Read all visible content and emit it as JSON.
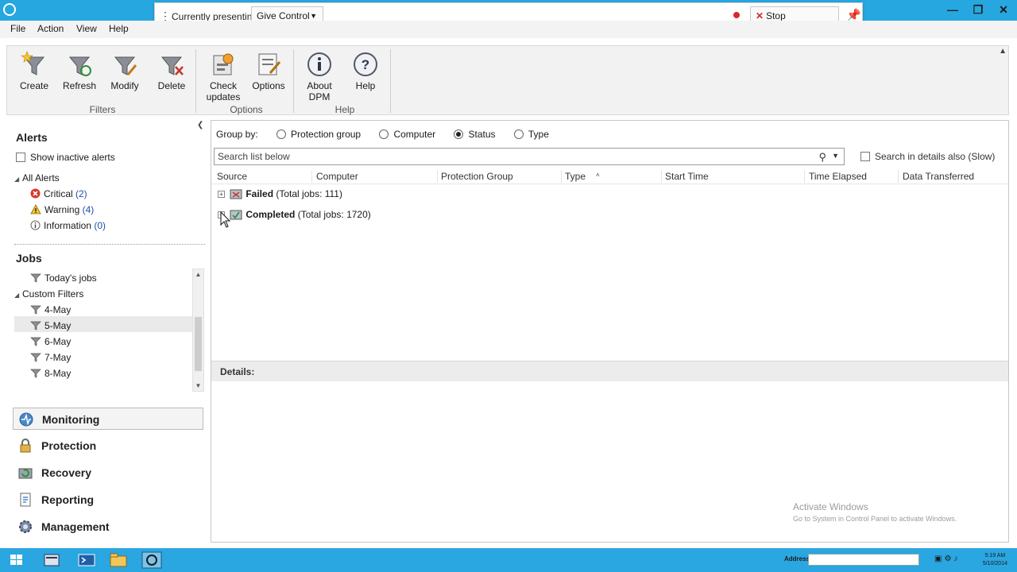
{
  "presenting": {
    "label": "Currently presenting",
    "give_control": "Give Control",
    "stop": "Stop Presenting"
  },
  "menu": [
    "File",
    "Action",
    "View",
    "Help"
  ],
  "ribbon": {
    "buttons": [
      {
        "label": "Create",
        "icon": "funnel-star-icon"
      },
      {
        "label": "Refresh",
        "icon": "funnel-refresh-icon"
      },
      {
        "label": "Modify",
        "icon": "funnel-edit-icon"
      },
      {
        "label": "Delete",
        "icon": "funnel-delete-icon"
      },
      {
        "label": "Check updates",
        "icon": "check-updates-icon"
      },
      {
        "label": "Options",
        "icon": "options-icon"
      },
      {
        "label": "About DPM",
        "icon": "info-icon"
      },
      {
        "label": "Help",
        "icon": "help-icon"
      }
    ],
    "groups": [
      "Filters",
      "Options",
      "Help"
    ]
  },
  "left": {
    "alerts_title": "Alerts",
    "show_inactive": "Show inactive alerts",
    "all_alerts": "All Alerts",
    "critical": {
      "label": "Critical",
      "count": "(2)"
    },
    "warning": {
      "label": "Warning",
      "count": "(4)"
    },
    "information": {
      "label": "Information",
      "count": "(0)"
    },
    "jobs_title": "Jobs",
    "todays_jobs": "Today's jobs",
    "custom_filters": "Custom Filters",
    "filters": [
      "4-May",
      "5-May",
      "6-May",
      "7-May",
      "8-May"
    ],
    "selected_filter": "5-May"
  },
  "nav": [
    {
      "label": "Monitoring",
      "icon": "monitoring-icon"
    },
    {
      "label": "Protection",
      "icon": "protection-icon"
    },
    {
      "label": "Recovery",
      "icon": "recovery-icon"
    },
    {
      "label": "Reporting",
      "icon": "reporting-icon"
    },
    {
      "label": "Management",
      "icon": "management-icon"
    }
  ],
  "main": {
    "group_by_label": "Group by:",
    "group_by_options": [
      "Protection group",
      "Computer",
      "Status",
      "Type"
    ],
    "group_by_selected": "Status",
    "search_placeholder": "Search list below",
    "search_details": "Search in details also (Slow)",
    "columns": [
      "Source",
      "Computer",
      "Protection Group",
      "Type",
      "Start Time",
      "Time Elapsed",
      "Data Transferred"
    ],
    "groups": [
      {
        "name": "Failed",
        "detail": "(Total jobs: 111)"
      },
      {
        "name": "Completed",
        "detail": "(Total jobs: 1720)"
      }
    ],
    "details_label": "Details:",
    "watermark_line1": "Activate Windows",
    "watermark_line2": "Go to System in Control Panel to activate Windows."
  },
  "taskbar": {
    "address_label": "Address",
    "time": "5:19 AM",
    "date": "5/10/2014"
  },
  "colors": {
    "titlebar": "#27a7e0",
    "taskbar": "#2aa6e0",
    "link_count": "#1f4fa8",
    "stop_red": "#d9262c"
  }
}
